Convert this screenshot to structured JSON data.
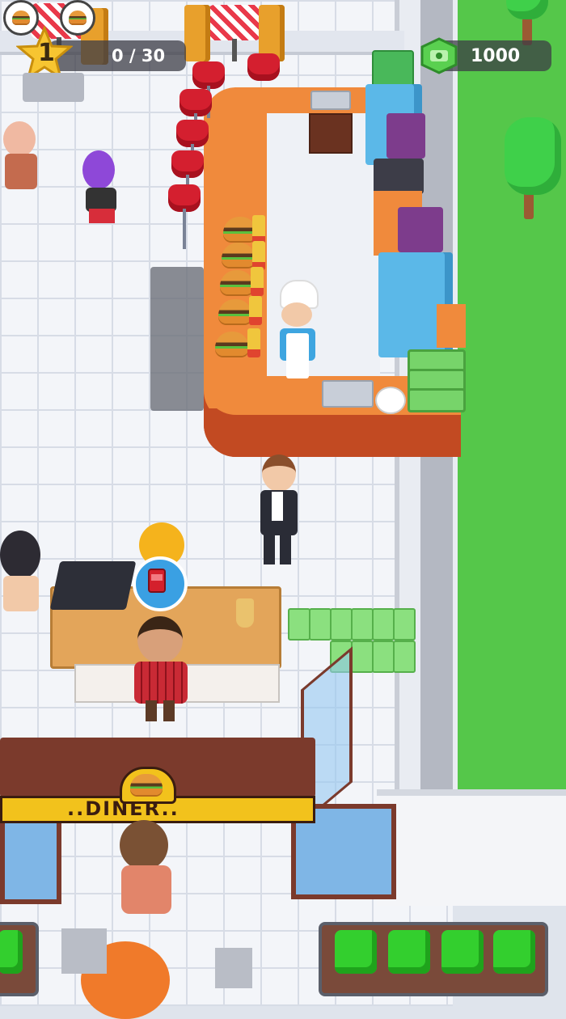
{
  "hud": {
    "level": "1",
    "customer_progress": "0 / 30",
    "money": "1000"
  },
  "sign": {
    "diner_label": "..DINER.."
  },
  "icons": {
    "level": "star-icon",
    "money": "cash-icon",
    "order_bubble": "burger-icon",
    "customer_request": "soda-icon"
  },
  "colors": {
    "counter": "#f08a3c",
    "counter_side": "#c24a22",
    "grass": "#55c74a",
    "cash": "#77d46a",
    "star": "#f7c531"
  }
}
